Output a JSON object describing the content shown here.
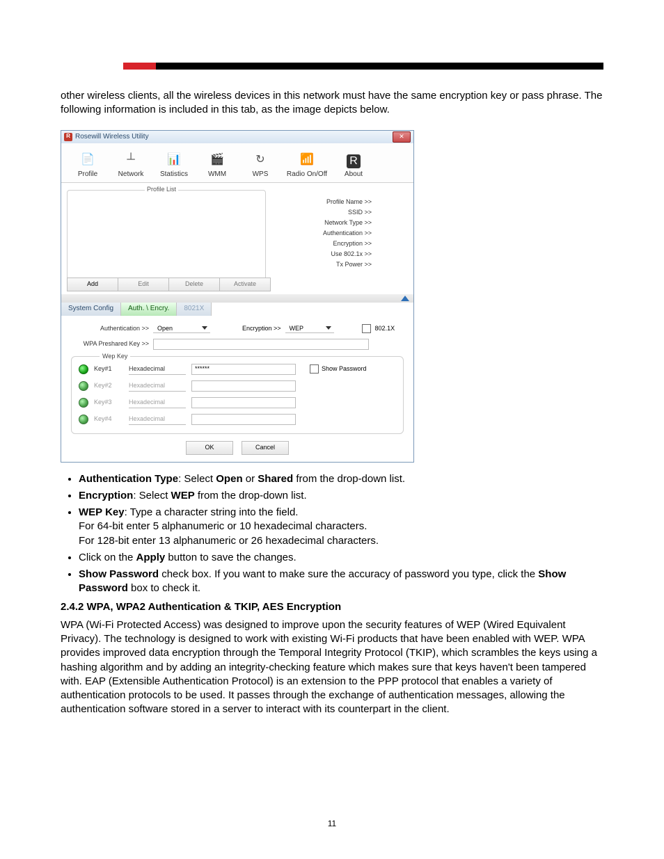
{
  "intro_text": "other wireless clients, all the wireless devices in this network must have the same encryption key or pass phrase.  The following information is included in this tab, as the image depicts below.",
  "app": {
    "title": "Rosewill Wireless Utility",
    "toolbar": [
      {
        "label": "Profile",
        "icon": "📄"
      },
      {
        "label": "Network",
        "icon": "┴"
      },
      {
        "label": "Statistics",
        "icon": "📊"
      },
      {
        "label": "WMM",
        "icon": "🎬"
      },
      {
        "label": "WPS",
        "icon": "↻"
      },
      {
        "label": "Radio On/Off",
        "icon": "📶"
      },
      {
        "label": "About",
        "icon": "R"
      }
    ],
    "profile_list_label": "Profile List",
    "profile_props": [
      "Profile Name >>",
      "SSID >>",
      "Network Type >>",
      "Authentication >>",
      "Encryption >>",
      "Use 802.1x >>",
      "Tx Power >>"
    ],
    "profile_buttons": {
      "add": "Add",
      "edit": "Edit",
      "delete": "Delete",
      "activate": "Activate"
    },
    "tabs": {
      "system_config": "System Config",
      "auth_encry": "Auth. \\ Encry.",
      "x8021": "8021X"
    },
    "fields": {
      "authentication_label": "Authentication >>",
      "authentication_value": "Open",
      "encryption_label": "Encryption >>",
      "encryption_value": "WEP",
      "cb_8021x": "802.1X",
      "wpa_preshared_label": "WPA Preshared Key >>"
    },
    "wep": {
      "legend": "Wep Key",
      "keys": [
        {
          "label": "Key#1",
          "format": "Hexadecimal",
          "value": "******",
          "enabled": true
        },
        {
          "label": "Key#2",
          "format": "Hexadecimal",
          "value": "",
          "enabled": false
        },
        {
          "label": "Key#3",
          "format": "Hexadecimal",
          "value": "",
          "enabled": false
        },
        {
          "label": "Key#4",
          "format": "Hexadecimal",
          "value": "",
          "enabled": false
        }
      ],
      "show_password": "Show Password"
    },
    "ok": "OK",
    "cancel": "Cancel"
  },
  "bullets": {
    "b1_a": "Authentication Type",
    "b1_b": ": Select ",
    "b1_c": "Open",
    "b1_d": " or ",
    "b1_e": "Shared",
    "b1_f": " from the drop-down list.",
    "b2_a": "Encryption",
    "b2_b": ": Select ",
    "b2_c": "WEP",
    "b2_d": " from the drop-down list.",
    "b3_a": "WEP Key",
    "b3_b": ": Type a character string into the field.",
    "b3_c": "For 64-bit enter 5 alphanumeric or 10 hexadecimal characters.",
    "b3_d": "For 128-bit enter 13 alphanumeric or 26 hexadecimal characters.",
    "b4_a": "Click on the ",
    "b4_b": "Apply",
    "b4_c": " button to save the changes.",
    "b5_a": "Show Password",
    "b5_b": " check box. If you want to make sure the accuracy of password you type, click the ",
    "b5_c": "Show Password",
    "b5_d": " box to check it."
  },
  "section_title": "2.4.2 WPA, WPA2 Authentication & TKIP, AES Encryption",
  "section_body": "WPA (Wi-Fi Protected Access) was designed to improve upon the security features of WEP (Wired Equivalent Privacy).  The technology is designed to work with existing Wi-Fi products that have been enabled with WEP.  WPA provides improved data encryption through the Temporal Integrity Protocol (TKIP), which scrambles the keys using a hashing algorithm and by adding an integrity-checking feature which makes sure that keys haven't been tampered with. EAP (Extensible Authentication Protocol) is an extension to the PPP protocol that enables a variety of authentication protocols to be used. It passes through the exchange of authentication messages, allowing the authentication software stored in a server to interact with its counterpart in the client.",
  "page_number": "11"
}
